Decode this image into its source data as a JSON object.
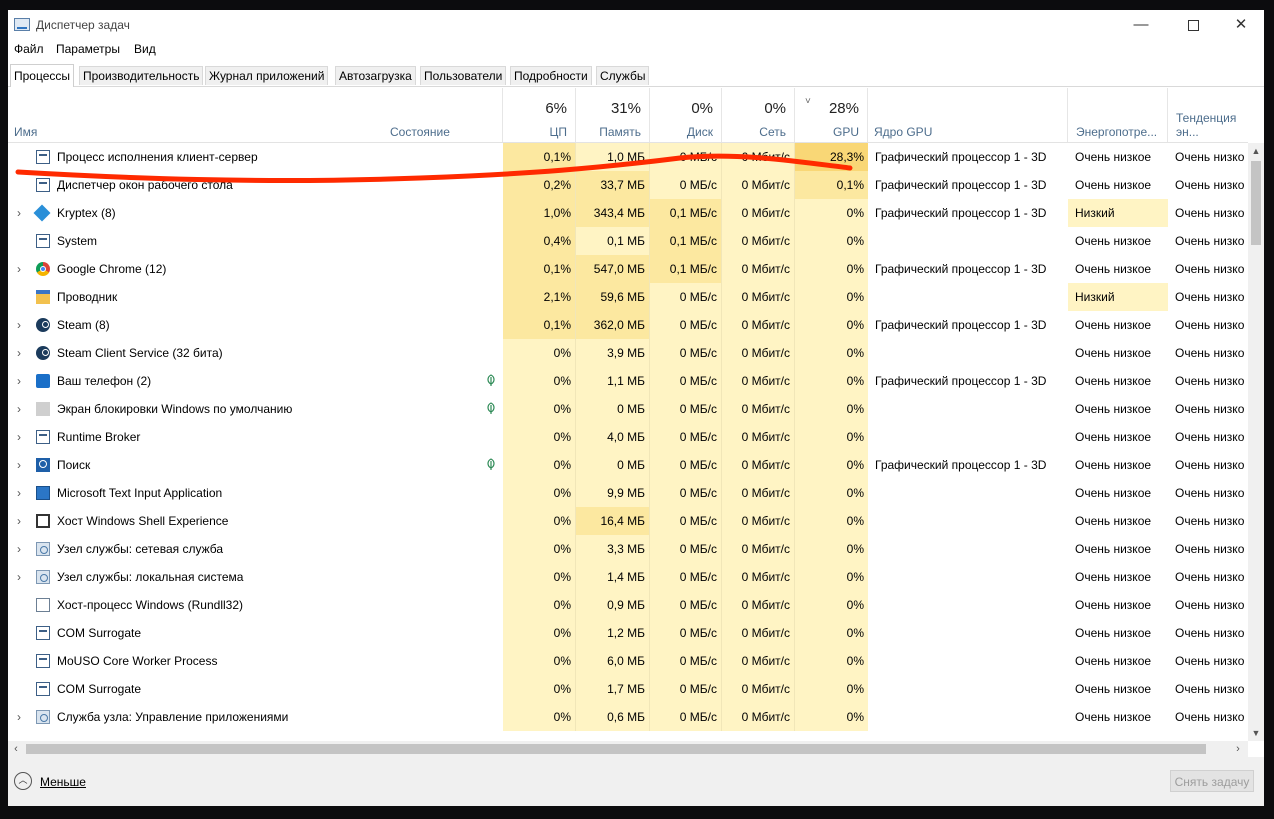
{
  "window": {
    "title": "Диспетчер задач",
    "controls": {
      "minimize": "—",
      "close": "✕"
    }
  },
  "menu": [
    "Файл",
    "Параметры",
    "Вид"
  ],
  "tabs": [
    {
      "label": "Процессы",
      "active": true
    },
    {
      "label": "Производительность"
    },
    {
      "label": "Журнал приложений"
    },
    {
      "label": "Автозагрузка"
    },
    {
      "label": "Пользователи"
    },
    {
      "label": "Подробности"
    },
    {
      "label": "Службы"
    }
  ],
  "columns": {
    "name": "Имя",
    "status": "Состояние",
    "cpu": {
      "label": "ЦП",
      "total": "6%"
    },
    "memory": {
      "label": "Память",
      "total": "31%"
    },
    "disk": {
      "label": "Диск",
      "total": "0%"
    },
    "network": {
      "label": "Сеть",
      "total": "0%"
    },
    "gpu": {
      "label": "GPU",
      "total": "28%"
    },
    "gpu_engine": "Ядро GPU",
    "power": "Энергопотре...",
    "power_trend": "Тенденция эн..."
  },
  "processes": [
    {
      "name": "Процесс исполнения клиент-сервер",
      "icon": "window-icon",
      "expandable": false,
      "eco": false,
      "cpu": "0,1%",
      "memory": "1,0 МБ",
      "disk": "0 МБ/с",
      "network": "0 Мбит/с",
      "gpu": "28,3%",
      "gpu_engine": "Графический процессор 1 - 3D",
      "power": "Очень низкое",
      "trend": "Очень низко"
    },
    {
      "name": "Диспетчер окон рабочего стола",
      "icon": "window-icon",
      "expandable": false,
      "eco": false,
      "cpu": "0,2%",
      "memory": "33,7 МБ",
      "disk": "0 МБ/с",
      "network": "0 Мбит/с",
      "gpu": "0,1%",
      "gpu_engine": "Графический процессор 1 - 3D",
      "power": "Очень низкое",
      "trend": "Очень низко"
    },
    {
      "name": "Kryptex (8)",
      "icon": "diamond-icon",
      "expandable": true,
      "eco": false,
      "cpu": "1,0%",
      "memory": "343,4 МБ",
      "disk": "0,1 МБ/с",
      "network": "0 Мбит/с",
      "gpu": "0%",
      "gpu_engine": "Графический процессор 1 - 3D",
      "power": "Низкий",
      "trend": "Очень низко"
    },
    {
      "name": "System",
      "icon": "window-icon",
      "expandable": false,
      "eco": false,
      "cpu": "0,4%",
      "memory": "0,1 МБ",
      "disk": "0,1 МБ/с",
      "network": "0 Мбит/с",
      "gpu": "0%",
      "gpu_engine": "",
      "power": "Очень низкое",
      "trend": "Очень низко"
    },
    {
      "name": "Google Chrome (12)",
      "icon": "chrome-icon",
      "expandable": true,
      "eco": false,
      "cpu": "0,1%",
      "memory": "547,0 МБ",
      "disk": "0,1 МБ/с",
      "network": "0 Мбит/с",
      "gpu": "0%",
      "gpu_engine": "Графический процессор 1 - 3D",
      "power": "Очень низкое",
      "trend": "Очень низко"
    },
    {
      "name": "Проводник",
      "icon": "folder-icon",
      "expandable": false,
      "eco": false,
      "cpu": "2,1%",
      "memory": "59,6 МБ",
      "disk": "0 МБ/с",
      "network": "0 Мбит/с",
      "gpu": "0%",
      "gpu_engine": "",
      "power": "Низкий",
      "trend": "Очень низко"
    },
    {
      "name": "Steam (8)",
      "icon": "steam-icon",
      "expandable": true,
      "eco": false,
      "cpu": "0,1%",
      "memory": "362,0 МБ",
      "disk": "0 МБ/с",
      "network": "0 Мбит/с",
      "gpu": "0%",
      "gpu_engine": "Графический процессор 1 - 3D",
      "power": "Очень низкое",
      "trend": "Очень низко"
    },
    {
      "name": "Steam Client Service (32 бита)",
      "icon": "steam-icon",
      "expandable": true,
      "eco": false,
      "cpu": "0%",
      "memory": "3,9 МБ",
      "disk": "0 МБ/с",
      "network": "0 Мбит/с",
      "gpu": "0%",
      "gpu_engine": "",
      "power": "Очень низкое",
      "trend": "Очень низко"
    },
    {
      "name": "Ваш телефон (2)",
      "icon": "phone-icon",
      "expandable": true,
      "eco": true,
      "cpu": "0%",
      "memory": "1,1 МБ",
      "disk": "0 МБ/с",
      "network": "0 Мбит/с",
      "gpu": "0%",
      "gpu_engine": "Графический процессор 1 - 3D",
      "power": "Очень низкое",
      "trend": "Очень низко"
    },
    {
      "name": "Экран блокировки Windows по умолчанию",
      "icon": "lockscreen-icon",
      "expandable": true,
      "eco": true,
      "cpu": "0%",
      "memory": "0 МБ",
      "disk": "0 МБ/с",
      "network": "0 Мбит/с",
      "gpu": "0%",
      "gpu_engine": "",
      "power": "Очень низкое",
      "trend": "Очень низко"
    },
    {
      "name": "Runtime Broker",
      "icon": "window-icon",
      "expandable": true,
      "eco": false,
      "cpu": "0%",
      "memory": "4,0 МБ",
      "disk": "0 МБ/с",
      "network": "0 Мбит/с",
      "gpu": "0%",
      "gpu_engine": "",
      "power": "Очень низкое",
      "trend": "Очень низко"
    },
    {
      "name": "Поиск",
      "icon": "search-icon",
      "expandable": true,
      "eco": true,
      "cpu": "0%",
      "memory": "0 МБ",
      "disk": "0 МБ/с",
      "network": "0 Мбит/с",
      "gpu": "0%",
      "gpu_engine": "Графический процессор 1 - 3D",
      "power": "Очень низкое",
      "trend": "Очень низко"
    },
    {
      "name": "Microsoft Text Input Application",
      "icon": "app-icon",
      "expandable": true,
      "eco": false,
      "cpu": "0%",
      "memory": "9,9 МБ",
      "disk": "0 МБ/с",
      "network": "0 Мбит/с",
      "gpu": "0%",
      "gpu_engine": "",
      "power": "Очень низкое",
      "trend": "Очень низко"
    },
    {
      "name": "Хост Windows Shell Experience",
      "icon": "shell-icon",
      "expandable": true,
      "eco": false,
      "cpu": "0%",
      "memory": "16,4 МБ",
      "disk": "0 МБ/с",
      "network": "0 Мбит/с",
      "gpu": "0%",
      "gpu_engine": "",
      "power": "Очень низкое",
      "trend": "Очень низко"
    },
    {
      "name": "Узел службы: сетевая служба",
      "icon": "gear-icon",
      "expandable": true,
      "eco": false,
      "cpu": "0%",
      "memory": "3,3 МБ",
      "disk": "0 МБ/с",
      "network": "0 Мбит/с",
      "gpu": "0%",
      "gpu_engine": "",
      "power": "Очень низкое",
      "trend": "Очень низко"
    },
    {
      "name": "Узел службы: локальная система",
      "icon": "gear-icon",
      "expandable": true,
      "eco": false,
      "cpu": "0%",
      "memory": "1,4 МБ",
      "disk": "0 МБ/с",
      "network": "0 Мбит/с",
      "gpu": "0%",
      "gpu_engine": "",
      "power": "Очень низкое",
      "trend": "Очень низко"
    },
    {
      "name": "Хост-процесс Windows (Rundll32)",
      "icon": "document-icon",
      "expandable": false,
      "eco": false,
      "cpu": "0%",
      "memory": "0,9 МБ",
      "disk": "0 МБ/с",
      "network": "0 Мбит/с",
      "gpu": "0%",
      "gpu_engine": "",
      "power": "Очень низкое",
      "trend": "Очень низко"
    },
    {
      "name": "COM Surrogate",
      "icon": "window-icon",
      "expandable": false,
      "eco": false,
      "cpu": "0%",
      "memory": "1,2 МБ",
      "disk": "0 МБ/с",
      "network": "0 Мбит/с",
      "gpu": "0%",
      "gpu_engine": "",
      "power": "Очень низкое",
      "trend": "Очень низко"
    },
    {
      "name": "MoUSO Core Worker Process",
      "icon": "window-icon",
      "expandable": false,
      "eco": false,
      "cpu": "0%",
      "memory": "6,0 МБ",
      "disk": "0 МБ/с",
      "network": "0 Мбит/с",
      "gpu": "0%",
      "gpu_engine": "",
      "power": "Очень низкое",
      "trend": "Очень низко"
    },
    {
      "name": "COM Surrogate",
      "icon": "window-icon",
      "expandable": false,
      "eco": false,
      "cpu": "0%",
      "memory": "1,7 МБ",
      "disk": "0 МБ/с",
      "network": "0 Мбит/с",
      "gpu": "0%",
      "gpu_engine": "",
      "power": "Очень низкое",
      "trend": "Очень низко"
    },
    {
      "name": "Служба узла: Управление приложениями",
      "icon": "gear-icon",
      "expandable": true,
      "eco": false,
      "cpu": "0%",
      "memory": "0,6 МБ",
      "disk": "0 МБ/с",
      "network": "0 Мбит/с",
      "gpu": "0%",
      "gpu_engine": "",
      "power": "Очень низкое",
      "trend": "Очень низко"
    }
  ],
  "footer": {
    "less_label": "Меньше",
    "end_task": "Снять задачу"
  },
  "colors": {
    "heat_low": "#fff4c4",
    "heat_mid": "#fce8a0",
    "heat_high": "#f9d776",
    "annotation_stroke": "#ff2a00"
  }
}
